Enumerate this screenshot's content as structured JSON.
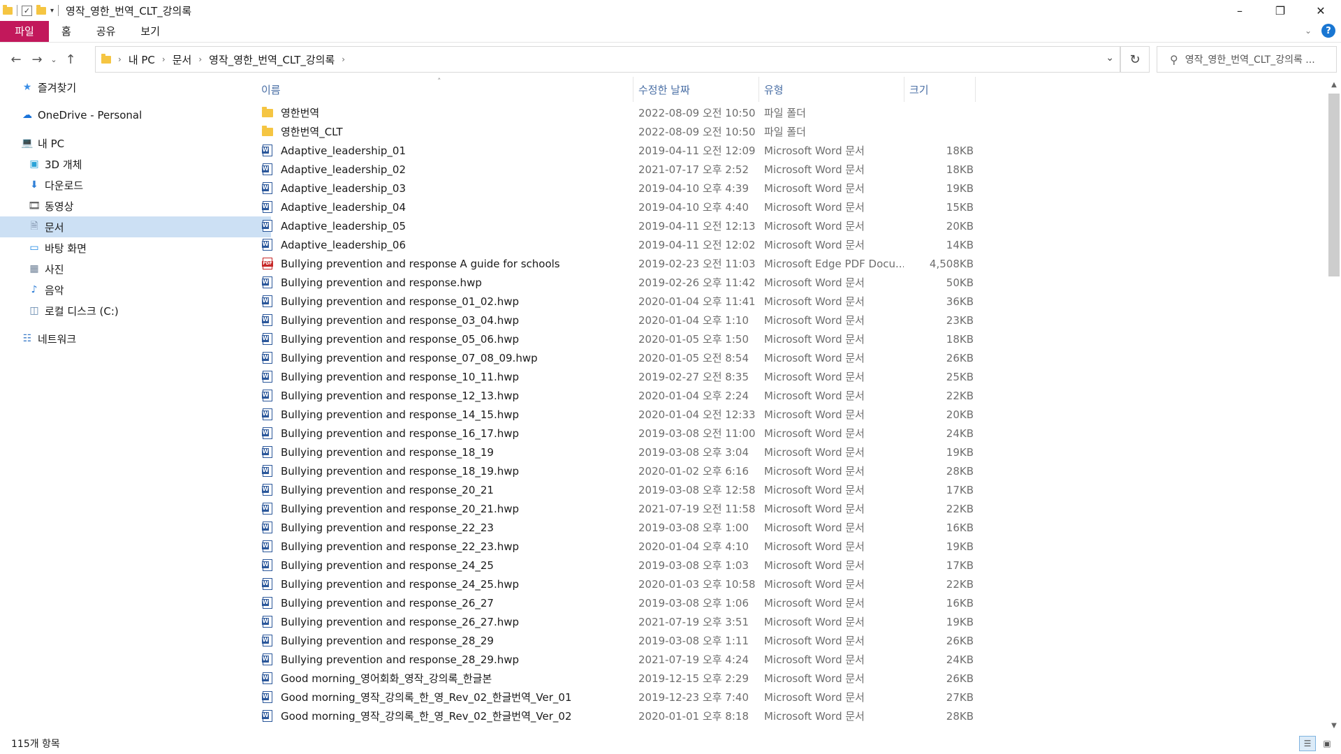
{
  "window": {
    "title": "영작_영한_번역_CLT_강의록"
  },
  "ribbon": {
    "tabs": [
      "파일",
      "홈",
      "공유",
      "보기"
    ]
  },
  "address": {
    "crumbs": [
      "내 PC",
      "문서",
      "영작_영한_번역_CLT_강의록"
    ],
    "search_placeholder": "영작_영한_번역_CLT_강의록 ..."
  },
  "nav": {
    "items": [
      {
        "label": "즐겨찾기",
        "icon": "star-icon"
      },
      {
        "label": "OneDrive - Personal",
        "icon": "cloud-icon"
      },
      {
        "label": "내 PC",
        "icon": "computer-icon"
      },
      {
        "label": "3D 개체",
        "icon": "cube-icon"
      },
      {
        "label": "다운로드",
        "icon": "download-icon"
      },
      {
        "label": "동영상",
        "icon": "film-icon"
      },
      {
        "label": "문서",
        "icon": "document-icon"
      },
      {
        "label": "바탕 화면",
        "icon": "desktop-icon"
      },
      {
        "label": "사진",
        "icon": "picture-icon"
      },
      {
        "label": "음악",
        "icon": "music-icon"
      },
      {
        "label": "로컬 디스크 (C:)",
        "icon": "disk-icon"
      },
      {
        "label": "네트워크",
        "icon": "network-icon"
      }
    ],
    "selected": "문서"
  },
  "columns": {
    "name": "이름",
    "date": "수정한 날짜",
    "type": "유형",
    "size": "크기"
  },
  "files": [
    {
      "name": "영한번역",
      "date": "2022-08-09 오전 10:50",
      "type": "파일 폴더",
      "size": "",
      "icon": "folder"
    },
    {
      "name": "영한번역_CLT",
      "date": "2022-08-09 오전 10:50",
      "type": "파일 폴더",
      "size": "",
      "icon": "folder"
    },
    {
      "name": "Adaptive_leadership_01",
      "date": "2019-04-11 오전 12:09",
      "type": "Microsoft Word 문서",
      "size": "18KB",
      "icon": "word"
    },
    {
      "name": "Adaptive_leadership_02",
      "date": "2021-07-17 오후 2:52",
      "type": "Microsoft Word 문서",
      "size": "18KB",
      "icon": "word"
    },
    {
      "name": "Adaptive_leadership_03",
      "date": "2019-04-10 오후 4:39",
      "type": "Microsoft Word 문서",
      "size": "19KB",
      "icon": "word"
    },
    {
      "name": "Adaptive_leadership_04",
      "date": "2019-04-10 오후 4:40",
      "type": "Microsoft Word 문서",
      "size": "15KB",
      "icon": "word"
    },
    {
      "name": "Adaptive_leadership_05",
      "date": "2019-04-11 오전 12:13",
      "type": "Microsoft Word 문서",
      "size": "20KB",
      "icon": "word"
    },
    {
      "name": "Adaptive_leadership_06",
      "date": "2019-04-11 오전 12:02",
      "type": "Microsoft Word 문서",
      "size": "14KB",
      "icon": "word"
    },
    {
      "name": "Bullying prevention and response A guide for schools",
      "date": "2019-02-23 오전 11:03",
      "type": "Microsoft Edge PDF Docu...",
      "size": "4,508KB",
      "icon": "pdf"
    },
    {
      "name": "Bullying prevention and response.hwp",
      "date": "2019-02-26 오후 11:42",
      "type": "Microsoft Word 문서",
      "size": "50KB",
      "icon": "word"
    },
    {
      "name": "Bullying prevention and response_01_02.hwp",
      "date": "2020-01-04 오후 11:41",
      "type": "Microsoft Word 문서",
      "size": "36KB",
      "icon": "word"
    },
    {
      "name": "Bullying prevention and response_03_04.hwp",
      "date": "2020-01-04 오후 1:10",
      "type": "Microsoft Word 문서",
      "size": "23KB",
      "icon": "word"
    },
    {
      "name": "Bullying prevention and response_05_06.hwp",
      "date": "2020-01-05 오후 1:50",
      "type": "Microsoft Word 문서",
      "size": "18KB",
      "icon": "word"
    },
    {
      "name": "Bullying prevention and response_07_08_09.hwp",
      "date": "2020-01-05 오전 8:54",
      "type": "Microsoft Word 문서",
      "size": "26KB",
      "icon": "word"
    },
    {
      "name": "Bullying prevention and response_10_11.hwp",
      "date": "2019-02-27 오전 8:35",
      "type": "Microsoft Word 문서",
      "size": "25KB",
      "icon": "word"
    },
    {
      "name": "Bullying prevention and response_12_13.hwp",
      "date": "2020-01-04 오후 2:24",
      "type": "Microsoft Word 문서",
      "size": "22KB",
      "icon": "word"
    },
    {
      "name": "Bullying prevention and response_14_15.hwp",
      "date": "2020-01-04 오전 12:33",
      "type": "Microsoft Word 문서",
      "size": "20KB",
      "icon": "word"
    },
    {
      "name": "Bullying prevention and response_16_17.hwp",
      "date": "2019-03-08 오전 11:00",
      "type": "Microsoft Word 문서",
      "size": "24KB",
      "icon": "word"
    },
    {
      "name": "Bullying prevention and response_18_19",
      "date": "2019-03-08 오후 3:04",
      "type": "Microsoft Word 문서",
      "size": "19KB",
      "icon": "word"
    },
    {
      "name": "Bullying prevention and response_18_19.hwp",
      "date": "2020-01-02 오후 6:16",
      "type": "Microsoft Word 문서",
      "size": "28KB",
      "icon": "word"
    },
    {
      "name": "Bullying prevention and response_20_21",
      "date": "2019-03-08 오후 12:58",
      "type": "Microsoft Word 문서",
      "size": "17KB",
      "icon": "word"
    },
    {
      "name": "Bullying prevention and response_20_21.hwp",
      "date": "2021-07-19 오전 11:58",
      "type": "Microsoft Word 문서",
      "size": "22KB",
      "icon": "word"
    },
    {
      "name": "Bullying prevention and response_22_23",
      "date": "2019-03-08 오후 1:00",
      "type": "Microsoft Word 문서",
      "size": "16KB",
      "icon": "word"
    },
    {
      "name": "Bullying prevention and response_22_23.hwp",
      "date": "2020-01-04 오후 4:10",
      "type": "Microsoft Word 문서",
      "size": "19KB",
      "icon": "word"
    },
    {
      "name": "Bullying prevention and response_24_25",
      "date": "2019-03-08 오후 1:03",
      "type": "Microsoft Word 문서",
      "size": "17KB",
      "icon": "word"
    },
    {
      "name": "Bullying prevention and response_24_25.hwp",
      "date": "2020-01-03 오후 10:58",
      "type": "Microsoft Word 문서",
      "size": "22KB",
      "icon": "word"
    },
    {
      "name": "Bullying prevention and response_26_27",
      "date": "2019-03-08 오후 1:06",
      "type": "Microsoft Word 문서",
      "size": "16KB",
      "icon": "word"
    },
    {
      "name": "Bullying prevention and response_26_27.hwp",
      "date": "2021-07-19 오후 3:51",
      "type": "Microsoft Word 문서",
      "size": "19KB",
      "icon": "word"
    },
    {
      "name": "Bullying prevention and response_28_29",
      "date": "2019-03-08 오후 1:11",
      "type": "Microsoft Word 문서",
      "size": "26KB",
      "icon": "word"
    },
    {
      "name": "Bullying prevention and response_28_29.hwp",
      "date": "2021-07-19 오후 4:24",
      "type": "Microsoft Word 문서",
      "size": "24KB",
      "icon": "word"
    },
    {
      "name": "Good morning_영어회화_영작_강의록_한글본",
      "date": "2019-12-15 오후 2:29",
      "type": "Microsoft Word 문서",
      "size": "26KB",
      "icon": "word"
    },
    {
      "name": "Good morning_영작_강의록_한_영_Rev_02_한글번역_Ver_01",
      "date": "2019-12-23 오후 7:40",
      "type": "Microsoft Word 문서",
      "size": "27KB",
      "icon": "word"
    },
    {
      "name": "Good morning_영작_강의록_한_영_Rev_02_한글번역_Ver_02",
      "date": "2020-01-01 오후 8:18",
      "type": "Microsoft Word 문서",
      "size": "28KB",
      "icon": "word"
    }
  ],
  "status": {
    "count": "115개 항목"
  },
  "colors": {
    "accent": "#c2185b",
    "selection": "#cce0f4",
    "header_text": "#4a6fa5"
  }
}
